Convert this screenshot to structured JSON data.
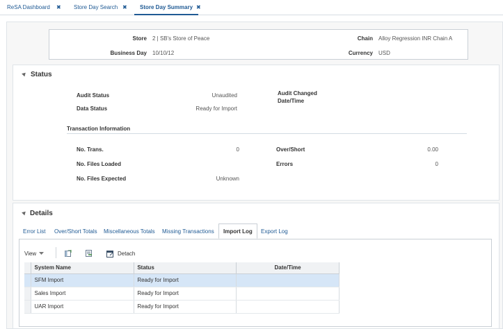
{
  "tabs": [
    {
      "label": "ReSA Dashboard",
      "close": "✖"
    },
    {
      "label": "Store Day Search",
      "close": "✖"
    },
    {
      "label": "Store Day Summary",
      "close": "✖"
    }
  ],
  "header": {
    "store_label": "Store",
    "store_value": "2 | SB's Store of Peace",
    "chain_label": "Chain",
    "chain_value": "Alloy Regression INR Chain A",
    "business_day_label": "Business Day",
    "business_day_value": "10/10/12",
    "currency_label": "Currency",
    "currency_value": "USD"
  },
  "status": {
    "title": "Status",
    "audit_status_label": "Audit Status",
    "audit_status_value": "Unaudited",
    "data_status_label": "Data Status",
    "data_status_value": "Ready for Import",
    "audit_changed_label_1": "Audit Changed",
    "audit_changed_label_2": "Date/Time",
    "transaction_info_label": "Transaction Information",
    "no_trans_label": "No. Trans.",
    "no_trans_value": "0",
    "no_files_loaded_label": "No. Files Loaded",
    "no_files_expected_label": "No. Files Expected",
    "no_files_expected_value": "Unknown",
    "over_short_label": "Over/Short",
    "over_short_value": "0.00",
    "errors_label": "Errors",
    "errors_value": "0"
  },
  "details": {
    "title": "Details",
    "tabs": [
      "Error List",
      "Over/Short Totals",
      "Miscellaneous Totals",
      "Missing Transactions",
      "Import Log",
      "Export Log"
    ],
    "toolbar": {
      "view_label": "View",
      "detach_label": "Detach"
    },
    "columns": [
      "System Name",
      "Status",
      "Date/Time"
    ],
    "rows": [
      {
        "system": "SFM Import",
        "status": "Ready for Import",
        "datetime": ""
      },
      {
        "system": "Sales Import",
        "status": "Ready for Import",
        "datetime": ""
      },
      {
        "system": "UAR Import",
        "status": "Ready for Import",
        "datetime": ""
      }
    ]
  },
  "colors": {
    "link": "#1f5a94",
    "selected_row": "#d6e6f7"
  },
  "icons": [
    "close-icon",
    "collapse-triangle-icon",
    "dropdown-arrow-icon",
    "freeze-icon",
    "wrap-icon",
    "detach-icon"
  ]
}
